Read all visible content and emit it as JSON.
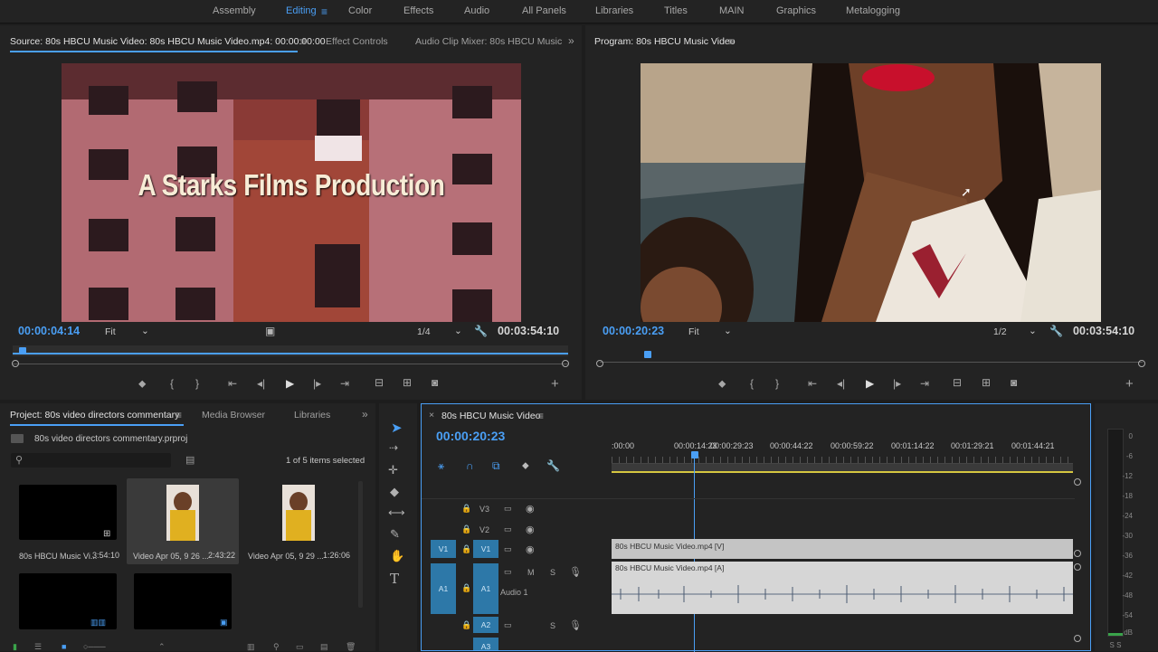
{
  "workspaces": {
    "items": [
      "Assembly",
      "Editing",
      "Color",
      "Effects",
      "Audio",
      "All Panels",
      "Libraries",
      "Titles",
      "MAIN",
      "Graphics",
      "Metalogging"
    ],
    "active": "Editing"
  },
  "source": {
    "tabs": [
      "Source: 80s HBCU Music Video: 80s HBCU Music Video.mp4: 00:00:00:00",
      "Effect Controls",
      "Audio Clip Mixer: 80s HBCU Music"
    ],
    "overlay_text": "A Starks Films Production",
    "timecode": "00:00:04:14",
    "fit": "Fit",
    "resolution": "1/4",
    "duration": "00:03:54:10",
    "playhead_fraction": 0.012
  },
  "program": {
    "title": "Program: 80s HBCU Music Video",
    "timecode": "00:00:20:23",
    "fit": "Fit",
    "resolution": "1/2",
    "duration": "00:03:54:10",
    "playhead_fraction": 0.081
  },
  "project": {
    "tabs": [
      "Project: 80s video directors commentary",
      "Media Browser",
      "Libraries"
    ],
    "filename": "80s video directors commentary.prproj",
    "selection": "1 of 5 items selected",
    "items": [
      {
        "name": "80s HBCU Music Vi...",
        "duration": "3:54:10"
      },
      {
        "name": "Video Apr 05, 9 26 ...",
        "duration": "2:43:22"
      },
      {
        "name": "Video Apr 05, 9 29 ...",
        "duration": "1:26:06"
      }
    ]
  },
  "timeline": {
    "title": "80s HBCU Music Video",
    "timecode": "00:00:20:23",
    "ruler": [
      ":00:00",
      "00:00:14:23",
      "00:00:29:23",
      "00:00:44:22",
      "00:00:59:22",
      "00:01:14:22",
      "00:01:29:21",
      "00:01:44:21"
    ],
    "tracks": {
      "v3": "V3",
      "v2": "V2",
      "v1": "V1",
      "v1src": "V1",
      "a1": "A1",
      "a1src": "A1",
      "a1name": "Audio 1",
      "a2": "A2",
      "a3": "A3",
      "m": "M",
      "s": "S"
    },
    "video_clip": "80s HBCU Music Video.mp4 [V]",
    "audio_clip": "80s HBCU Music Video.mp4 [A]"
  },
  "meter": {
    "levels": [
      "0",
      "-6",
      "-12",
      "-18",
      "-24",
      "-30",
      "-36",
      "-42",
      "-48",
      "-54",
      "dB"
    ],
    "solo": "S  S"
  },
  "colors": {
    "accent": "#4a9ff5",
    "panel": "#232323",
    "bg": "#1d1d1d"
  },
  "icons": [
    "selection-tool-icon",
    "track-select-icon",
    "ripple-edit-icon",
    "razor-icon",
    "slip-icon",
    "pen-icon",
    "hand-icon",
    "type-icon",
    "play-icon",
    "camera-icon",
    "wrench-icon",
    "plus-icon",
    "eye-icon",
    "lock-icon",
    "microphone-icon"
  ]
}
